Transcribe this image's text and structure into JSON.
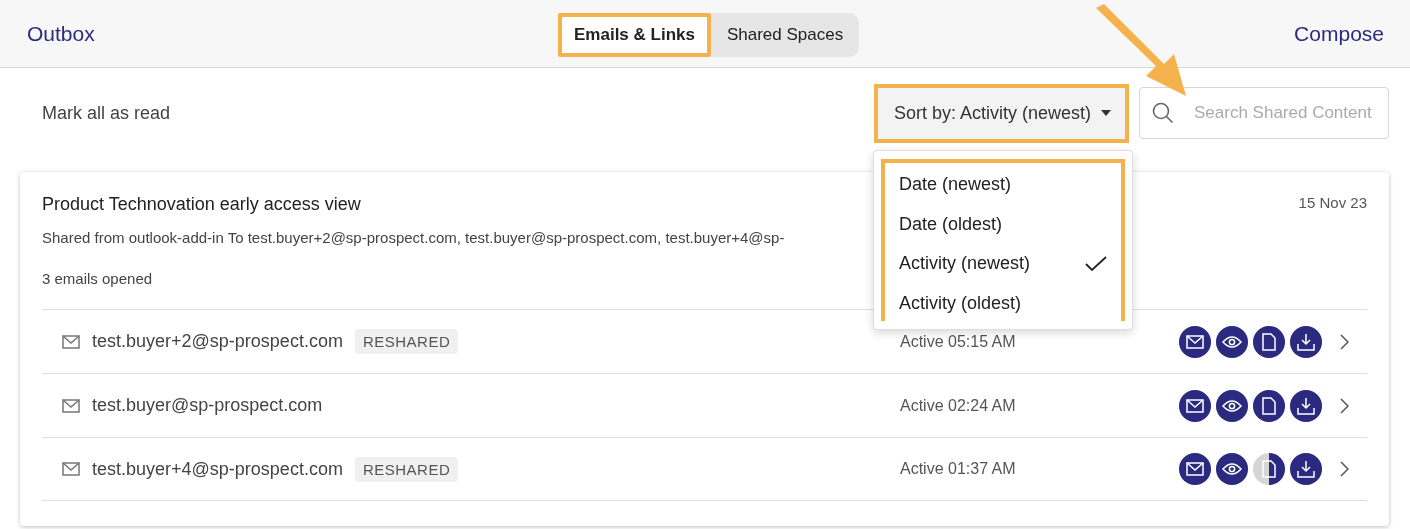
{
  "header": {
    "title": "Outbox",
    "tabs": [
      {
        "label": "Emails & Links",
        "selected": true
      },
      {
        "label": "Shared Spaces",
        "selected": false
      }
    ],
    "compose": "Compose"
  },
  "toolbar": {
    "mark_all": "Mark all as read",
    "sort": "Sort by: Activity (newest)",
    "search": {
      "placeholder": "Search Shared Content"
    }
  },
  "sort_menu": [
    {
      "label": "Date (newest)",
      "selected": false
    },
    {
      "label": "Date (oldest)",
      "selected": false
    },
    {
      "label": "Activity (newest)",
      "selected": true
    },
    {
      "label": "Activity (oldest)",
      "selected": false
    }
  ],
  "card": {
    "title": "Product Technovation early access view",
    "date": "15 Nov 23",
    "shared": "Shared from outlook-add-in To test.buyer+2@sp-prospect.com, test.buyer@sp-prospect.com, test.buyer+4@sp-",
    "opened": "3 emails opened",
    "recipients": [
      {
        "email": "test.buyer+2@sp-prospect.com",
        "badge": "RESHARED",
        "activity": "Active 05:15 AM",
        "actions": [
          {
            "kind": "email",
            "level": 1
          },
          {
            "kind": "view",
            "level": 1
          },
          {
            "kind": "document",
            "level": 1
          },
          {
            "kind": "download",
            "level": 1
          }
        ]
      },
      {
        "email": "test.buyer@sp-prospect.com",
        "activity": "Active 02:24 AM",
        "actions": [
          {
            "kind": "email",
            "level": 1
          },
          {
            "kind": "view",
            "level": 1
          },
          {
            "kind": "document",
            "level": 1
          },
          {
            "kind": "download",
            "level": 1
          }
        ]
      },
      {
        "email": "test.buyer+4@sp-prospect.com",
        "badge": "RESHARED",
        "activity": "Active 01:37 AM",
        "actions": [
          {
            "kind": "email",
            "level": 1
          },
          {
            "kind": "view",
            "level": 1
          },
          {
            "kind": "document",
            "level": 0.5
          },
          {
            "kind": "download",
            "level": 1
          }
        ]
      }
    ]
  }
}
